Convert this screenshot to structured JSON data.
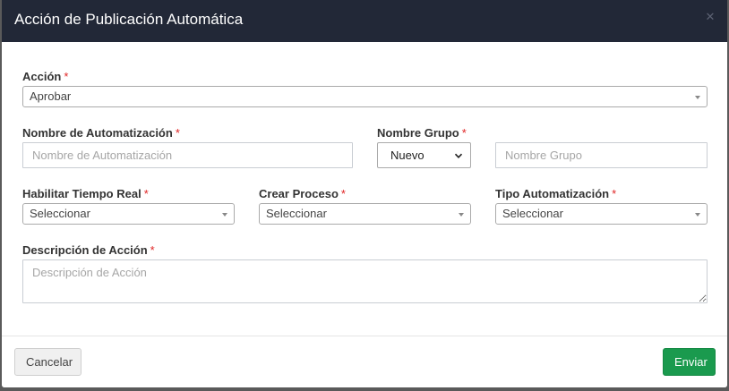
{
  "modal": {
    "title": "Acción de Publicación Automática",
    "close_icon": "close-icon"
  },
  "required_marker": "*",
  "form": {
    "accion": {
      "label": "Acción",
      "value": "Aprobar"
    },
    "nombre_automatizacion": {
      "label": "Nombre de Automatización",
      "placeholder": "Nombre de Automatización",
      "value": ""
    },
    "nombre_grupo": {
      "label": "Nombre Grupo",
      "select_value": "Nuevo",
      "placeholder": "Nombre Grupo",
      "value": ""
    },
    "habilitar_tiempo_real": {
      "label": "Habilitar Tiempo Real",
      "value": "Seleccionar"
    },
    "crear_proceso": {
      "label": "Crear Proceso",
      "value": "Seleccionar"
    },
    "tipo_automatizacion": {
      "label": "Tipo Automatización",
      "value": "Seleccionar"
    },
    "descripcion": {
      "label": "Descripción de Acción",
      "placeholder": "Descripción de Acción",
      "value": ""
    }
  },
  "footer": {
    "cancel_label": "Cancelar",
    "send_label": "Enviar"
  },
  "colors": {
    "header_bg": "#222837",
    "required": "#e02424",
    "primary_button": "#1a9a4e"
  }
}
